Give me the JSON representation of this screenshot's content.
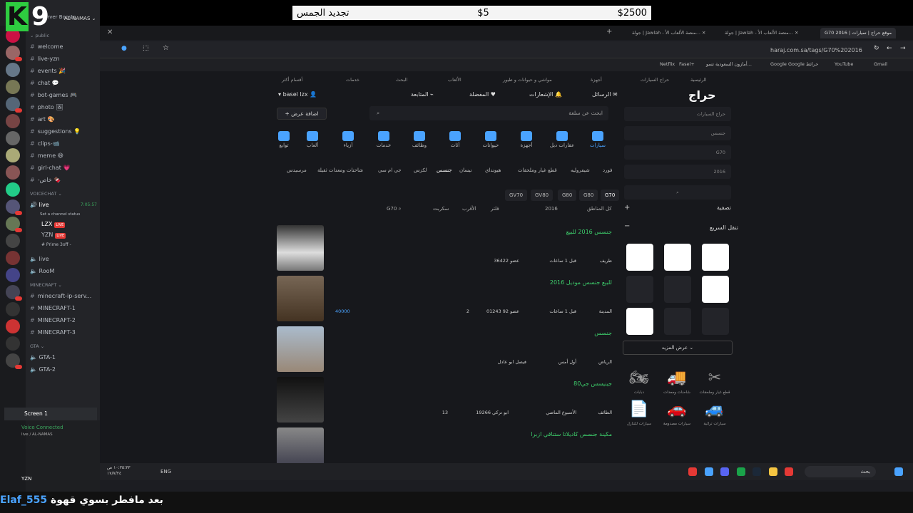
{
  "overlay": {
    "channel_logo": "K",
    "channel_num": "9",
    "price_right": "$2500",
    "price_mid": "$5",
    "price_left": "تجديد الجمس",
    "bottom_text": "بعد مافطر بسوي قهوة",
    "bottom_user": "Elaf_555"
  },
  "discord": {
    "server_name": "AL-NAMAS",
    "server_boosts": "Server Boosts",
    "cat_public": "public",
    "channels": [
      "welcome",
      "live-yzn",
      "events 🎉",
      "chat 💬",
      "bot-games 🎮",
      "photo 🖼",
      "art 🎨",
      "suggestions 💡",
      "clips-📹",
      "meme 😄",
      "girl-chat 💗",
      "-خاص 🍫"
    ],
    "cat_voice": "VOICECHAT",
    "voice_live": "live",
    "voice_time": "7:05:57",
    "voice_status": "Set a channel status",
    "voice_users": [
      "LZX",
      "YZN",
      "# Prime 3off -"
    ],
    "voice_extra": [
      "live",
      "RooM"
    ],
    "cat_mc": "MINECRAFT",
    "mc_channels": [
      "minecraft-ip-serv...",
      "MINECRAFT-1",
      "MINECRAFT-2",
      "MINECRAFT-3"
    ],
    "cat_gta": "GTA",
    "gta_channels": [
      "GTA-1",
      "GTA-2"
    ],
    "screen_label": "Screen 1",
    "voice_connected": "Voice Connected",
    "voice_connected_sub": "live / AL-NAMAS",
    "user_tag": "YZN",
    "live_label": "LIVE"
  },
  "browser": {
    "tabs": [
      "G70 2016 | موقع حراج | سيارات",
      "جولة | Jawlah - منصة الألعاب الأ...",
      "جولة | Jawlah - منصة الألعاب الأ..."
    ],
    "url": "haraj.com.sa/tags/G70%202016",
    "bookmarks": [
      "Gmail",
      "YouTube",
      "Google خرائط",
      "Google",
      "أمازون السعودية تسو...",
      "Fasel+",
      "Netflix"
    ]
  },
  "site": {
    "logo": "حراج",
    "nav": [
      "الرئيسية",
      "حراج السيارات",
      "أجهزة",
      "مواشي و حيوانات و طيور",
      "الألعاب",
      "البحث",
      "خدمات",
      "أقسام أكثر"
    ],
    "top_buttons": [
      "الرسائل",
      "الإشعارات",
      "المفضلة",
      "المتابعة"
    ],
    "user": "basel lzx",
    "add_offer": "اضافة عرض",
    "search_placeholder": "ابحث عن سلعة",
    "side_inputs": [
      "حراج السيارات",
      "جنسس",
      "G70",
      "2016"
    ],
    "categories": [
      "سيارات",
      "عقارات ديل",
      "أجهزة",
      "حيوانات",
      "أثاث",
      "وظائف",
      "خدمات",
      "أزياء",
      "ألعاب",
      "توابع"
    ],
    "brands": [
      "فورد",
      "شيفروليه",
      "قطع غيار وملحقات",
      "هيونداي",
      "نيسان",
      "جنسس",
      "لكزس",
      "جي ام سي",
      "شاحنات ومعدات ثقيلة",
      "مرسيدس"
    ],
    "chips": [
      "G70",
      "G80",
      "G80",
      "GV80",
      "GV70"
    ],
    "filters": [
      "كل المناطق",
      "2016",
      "فلتر",
      "الأقرب",
      "سكربت",
      "G70"
    ],
    "filter_heading": "تصفية",
    "quick_heading": "تنقل السريع",
    "show_more": "عرض المزيد",
    "quick_items": [
      "قطع غيار وملحقات",
      "شاحنات ومعدات",
      "دبابات",
      "سيارات تراثية",
      "سيارات مصدومة",
      "سيارات للتنازل"
    ],
    "posts": [
      {
        "title": "جنسس 2016 للبيع",
        "city": "طريف",
        "time": "قبل 1 ساعات",
        "user": "عضو 36422",
        "extra": ""
      },
      {
        "title": "للبيع جنسس موديل 2016",
        "city": "المدينة",
        "time": "قبل 1 ساعات",
        "user": "عضو 92 01243",
        "comments": "2",
        "price": "40000"
      },
      {
        "title": "جنسس",
        "city": "الرياض",
        "time": "أول أمس",
        "user": "فيصل ابو عادل",
        "extra": ""
      },
      {
        "title": "جينيسس جي80",
        "city": "الطائف",
        "time": "الأسبوع الماضي",
        "user": "ابو تركي 19266",
        "comments": "13"
      },
      {
        "title": "مكينة جنسس كاديلاتا ستناقي ازبرا",
        "city": "",
        "time": "",
        "user": "",
        "extra": ""
      }
    ]
  },
  "taskbar": {
    "lang": "ENG",
    "time": "١٠:٣٥:٣٣ ص",
    "date": "١٧/٧/٢٤",
    "search": "بحث"
  }
}
